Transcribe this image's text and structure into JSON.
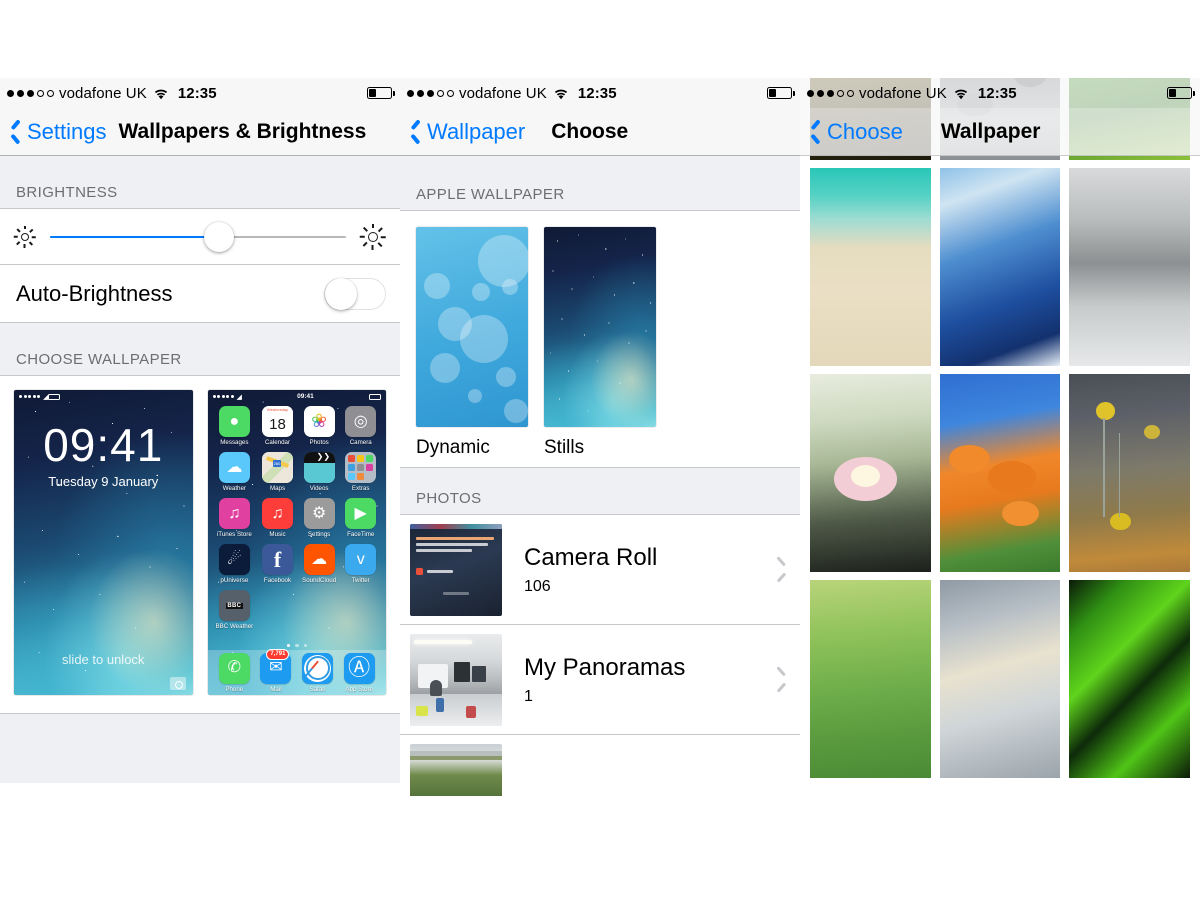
{
  "status_bar": {
    "signal_dots_filled": 3,
    "signal_dots_total": 5,
    "carrier": "vodafone UK",
    "time": "12:35",
    "wifi_icon": "wifi-icon",
    "battery_icon": "battery-icon",
    "battery_level_pct": 30
  },
  "colors": {
    "ios_blue": "#007AFF",
    "group_bg": "#EFF0F4",
    "separator": "#C8C7CC",
    "header_text": "#6D6D72",
    "badge_red": "#FF3B30"
  },
  "panel1": {
    "nav": {
      "back_label": "Settings",
      "back_icon": "chevron-left-icon",
      "title": "Wallpapers & Brightness"
    },
    "brightness": {
      "section_header": "BRIGHTNESS",
      "slider_value_pct": 57,
      "icon_low": "sun-small-icon",
      "icon_high": "sun-large-icon",
      "auto_brightness_label": "Auto-Brightness",
      "auto_brightness_on": false
    },
    "choose_wallpaper": {
      "section_header": "CHOOSE WALLPAPER",
      "lock_preview": {
        "name": "lock-screen-preview",
        "time": "09:41",
        "date": "Tuesday 9 January",
        "slide_hint": "slide to unlock",
        "camera_icon": "camera-icon"
      },
      "home_preview": {
        "name": "home-screen-preview",
        "time": "09:41",
        "apps": [
          {
            "label": "Messages",
            "icon": "messages-icon",
            "color": "#4CD964",
            "glyph": "●"
          },
          {
            "label": "Calendar",
            "icon": "calendar-icon",
            "color": "#FFFFFF",
            "glyph": "18",
            "day": "Wednesday"
          },
          {
            "label": "Photos",
            "icon": "photos-icon",
            "color": "#FFFFFF",
            "glyph": "❀"
          },
          {
            "label": "Camera",
            "icon": "camera-icon",
            "color": "#8E8E93",
            "glyph": "◎"
          },
          {
            "label": "Weather",
            "icon": "weather-icon",
            "color": "#5AC8FA",
            "glyph": "☁"
          },
          {
            "label": "Maps",
            "icon": "maps-icon",
            "color": "#E8E3D8",
            "glyph": ""
          },
          {
            "label": "Videos",
            "icon": "videos-icon",
            "color": "#5AC8D2",
            "glyph": "▶"
          },
          {
            "label": "Extras",
            "icon": "extras-folder-icon",
            "color": "#9AA3AE",
            "glyph": ""
          },
          {
            "label": "iTunes Store",
            "icon": "itunes-store-icon",
            "color": "#E040A0",
            "glyph": "♫"
          },
          {
            "label": "Music",
            "icon": "music-icon",
            "color": "#FC3D39",
            "glyph": "♫"
          },
          {
            "label": "Settings",
            "icon": "settings-gear-icon",
            "color": "#9B9B9B",
            "glyph": "⚙"
          },
          {
            "label": "FaceTime",
            "icon": "facetime-icon",
            "color": "#4CD964",
            "glyph": "▶"
          },
          {
            "label": "pUniverse",
            "icon": "puniverse-icon",
            "color": "#0B1B3A",
            "glyph": "☄"
          },
          {
            "label": "Facebook",
            "icon": "facebook-icon",
            "color": "#3B5998",
            "glyph": "f"
          },
          {
            "label": "SoundCloud",
            "icon": "soundcloud-icon",
            "color": "#FF5500",
            "glyph": "☁"
          },
          {
            "label": "Twitter",
            "icon": "twitter-icon",
            "color": "#3BA9EE",
            "glyph": "ᴠ"
          },
          {
            "label": "BBC Weather",
            "icon": "bbc-weather-icon",
            "color": "#55606B",
            "glyph": "BBC"
          }
        ],
        "page_dots": 3,
        "page_active": 1,
        "dock": [
          {
            "label": "Phone",
            "icon": "phone-icon",
            "color": "#4CD964",
            "glyph": "✆"
          },
          {
            "label": "Mail",
            "icon": "mail-icon",
            "color": "#1D9BF0",
            "glyph": "✉",
            "badge": "7,791"
          },
          {
            "label": "Safari",
            "icon": "safari-compass-icon",
            "color": "#1D9BF0",
            "glyph": "✦"
          },
          {
            "label": "App Store",
            "icon": "app-store-icon",
            "color": "#1D9BF0",
            "glyph": "Ⓐ"
          }
        ]
      }
    }
  },
  "panel2": {
    "nav": {
      "back_label": "Wallpaper",
      "back_icon": "chevron-left-icon",
      "title": "Choose"
    },
    "apple_wallpaper": {
      "section_header": "APPLE WALLPAPER",
      "items": [
        {
          "label": "Dynamic",
          "thumb": "dynamic-bokeh-thumbnail"
        },
        {
          "label": "Stills",
          "thumb": "ios7-nebula-thumbnail"
        }
      ]
    },
    "photos": {
      "section_header": "PHOTOS",
      "albums": [
        {
          "title": "Camera Roll",
          "count": "106",
          "thumb": "notification-center-screenshot-thumbnail",
          "chevron": "chevron-right-icon"
        },
        {
          "title": "My Panoramas",
          "count": "1",
          "thumb": "office-desks-photo-thumbnail",
          "chevron": "chevron-right-icon"
        },
        {
          "title": "",
          "count": "",
          "thumb": "panorama-photo-thumbnail-partial",
          "chevron": "chevron-right-icon"
        }
      ]
    }
  },
  "panel3": {
    "nav": {
      "back_label": "Choose",
      "back_icon": "chevron-left-icon",
      "title": "Wallpaper"
    },
    "grid": [
      {
        "name": "wallpaper-golden-hills",
        "row": 1
      },
      {
        "name": "wallpaper-stepping-stones-bw",
        "row": 1
      },
      {
        "name": "wallpaper-green-rice-field",
        "row": 1
      },
      {
        "name": "wallpaper-turquoise-beach",
        "row": 2
      },
      {
        "name": "wallpaper-blue-wave",
        "row": 2
      },
      {
        "name": "wallpaper-grayscale-wave",
        "row": 2
      },
      {
        "name": "wallpaper-pink-water-lily",
        "row": 3
      },
      {
        "name": "wallpaper-orange-poppies",
        "row": 3
      },
      {
        "name": "wallpaper-yellow-craspedia",
        "row": 3
      },
      {
        "name": "wallpaper-dewy-grass",
        "row": 4
      },
      {
        "name": "wallpaper-reeds-sunrise",
        "row": 4
      },
      {
        "name": "wallpaper-green-blades",
        "row": 4
      }
    ]
  }
}
